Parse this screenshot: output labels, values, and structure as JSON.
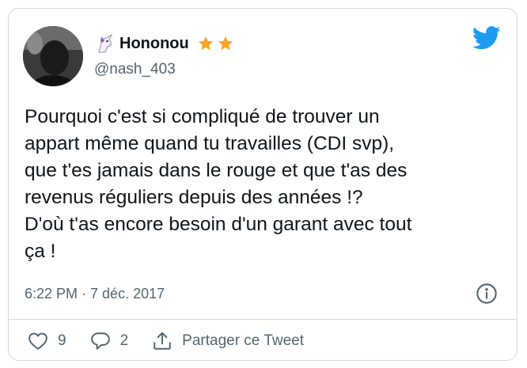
{
  "user": {
    "display_name": "Hononou",
    "handle": "@nash_403",
    "badge_icons": [
      "unicorn-emoji",
      "star-emoji",
      "star-emoji"
    ]
  },
  "tweet": {
    "text": "Pourquoi c'est si compliqué de trouver un\nappart même quand tu travailles (CDI svp),\nque t'es jamais dans le rouge et que t'as des\nrevenus réguliers depuis des années !?\nD'où t'as encore besoin d'un garant avec tout\nça !",
    "timestamp": "6:22 PM · 7 déc. 2017"
  },
  "actions": {
    "like_count": "9",
    "reply_count": "2",
    "share_label": "Partager ce Tweet"
  },
  "icons": {
    "brand": "twitter-bird-icon",
    "info": "info-icon",
    "like": "heart-icon",
    "reply": "reply-icon",
    "share": "share-icon"
  },
  "colors": {
    "twitter_blue": "#1d9bf0",
    "text_primary": "#0f1419",
    "text_secondary": "#536471",
    "border": "#cfd9de",
    "star": "#f5a623"
  }
}
